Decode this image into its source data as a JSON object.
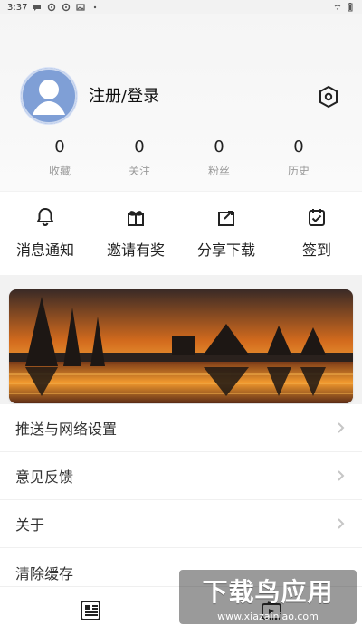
{
  "status_bar": {
    "time": "3:37",
    "icons_left": [
      "chat-bubble-icon",
      "settings-icon",
      "settings-icon",
      "image-icon",
      "dot-icon"
    ],
    "icons_right": [
      "wifi-icon",
      "battery-icon"
    ]
  },
  "profile": {
    "avatar": "default-avatar",
    "login_label": "注册/登录",
    "settings_icon": "hexagon-settings-icon",
    "stats": [
      {
        "value": "0",
        "label": "收藏"
      },
      {
        "value": "0",
        "label": "关注"
      },
      {
        "value": "0",
        "label": "粉丝"
      },
      {
        "value": "0",
        "label": "历史"
      }
    ]
  },
  "quick_actions": [
    {
      "label": "消息通知",
      "icon": "bell-icon"
    },
    {
      "label": "邀请有奖",
      "icon": "gift-icon"
    },
    {
      "label": "分享下载",
      "icon": "share-icon"
    },
    {
      "label": "签到",
      "icon": "calendar-check-icon"
    }
  ],
  "banner": {
    "image": "oil-field-sunset"
  },
  "menu": [
    {
      "label": "推送与网络设置"
    },
    {
      "label": "意见反馈"
    },
    {
      "label": "关于"
    },
    {
      "label": "清除缓存"
    }
  ],
  "bottom_nav": [
    {
      "icon": "news-icon"
    },
    {
      "icon": "video-play-icon"
    }
  ],
  "watermark": {
    "title": "下载鸟应用",
    "url": "www.xiazainiao.com"
  },
  "colors": {
    "accent": "#7f9fd6",
    "text": "#222222",
    "muted": "#9b9b9b"
  }
}
